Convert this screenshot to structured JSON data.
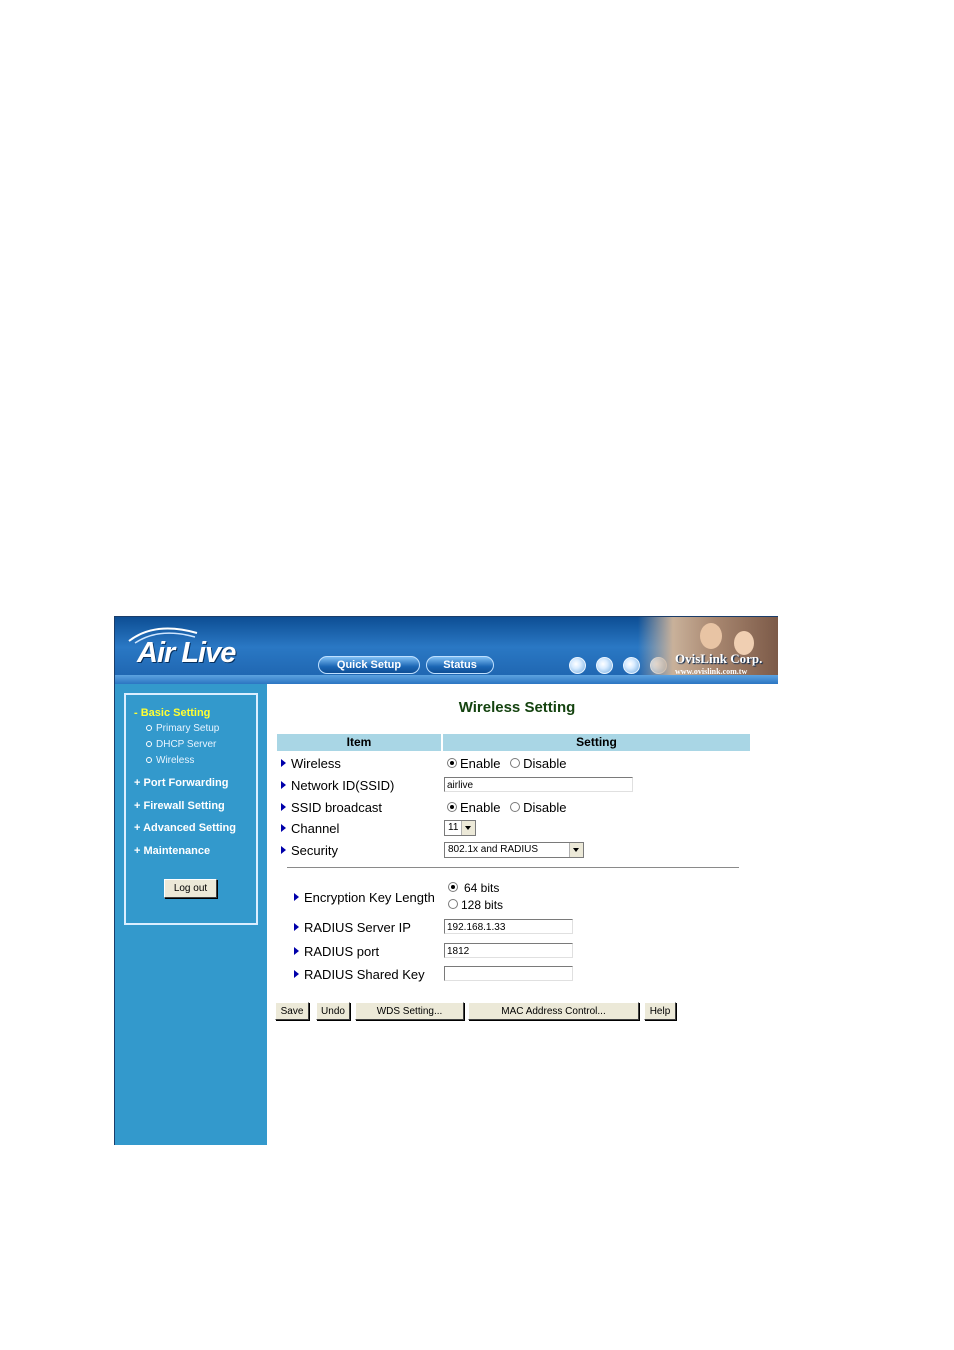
{
  "banner": {
    "logo": "Air Live",
    "quick_setup": "Quick Setup",
    "status": "Status",
    "corp_name": "OvisLink Corp.",
    "corp_url": "www.ovislink.com.tw"
  },
  "sidebar": {
    "basic_setting": "- Basic Setting",
    "sub_items": [
      "Primary Setup",
      "DHCP Server",
      "Wireless"
    ],
    "port_forwarding": "+ Port Forwarding",
    "firewall_setting": "+ Firewall Setting",
    "advanced_setting": "+ Advanced Setting",
    "maintenance": "+ Maintenance",
    "logout": "Log out"
  },
  "main": {
    "title": "Wireless Setting",
    "col_item": "Item",
    "col_setting": "Setting",
    "wireless_label": "Wireless",
    "ssid_label": "Network ID(SSID)",
    "ssid_value": "airlive",
    "broadcast_label": "SSID broadcast",
    "channel_label": "Channel",
    "channel_value": "11",
    "security_label": "Security",
    "security_value": "802.1x and RADIUS",
    "enable": "Enable",
    "disable": "Disable",
    "enc_key_label": "Encryption Key Length",
    "bits64": "64 bits",
    "bits128": "128 bits",
    "radius_ip_label": "RADIUS Server IP",
    "radius_ip_value": "192.168.1.33",
    "radius_port_label": "RADIUS port",
    "radius_port_value": "1812",
    "radius_key_label": "RADIUS Shared Key",
    "radius_key_value": ""
  },
  "buttons": {
    "save": "Save",
    "undo": "Undo",
    "wds": "WDS Setting...",
    "mac": "MAC Address Control...",
    "help": "Help"
  },
  "colors": {
    "sidebar_bg": "#3399cc",
    "header_bg": "#a9d6e5",
    "title_green": "#14430f",
    "active_menu": "#ffff33"
  }
}
